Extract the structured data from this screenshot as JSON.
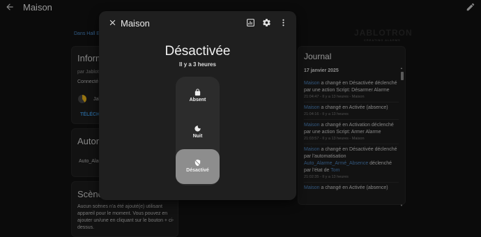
{
  "topbar": {
    "title": "Maison"
  },
  "background": {
    "breadcrumb": "Dans Hall Ent",
    "brand": "JABLOTRON",
    "brand_sub": "CREATING ALARMS",
    "info_card": {
      "title": "Inform",
      "by": "par Jablot",
      "connected": "Connecté v",
      "device": "Jab",
      "action": "TÉLÉCHA"
    },
    "auto_card": {
      "title": "Autom",
      "item": "Auto_Alar"
    },
    "scenes_card": {
      "title": "Scènes",
      "text": "Aucun scènes n'a été ajouté(e) utilisant appareil pour le moment. Vous pouvez en ajouter un/une en cliquant sur le bouton + ci-dessus."
    }
  },
  "journal": {
    "title": "Journal",
    "date": "17 janvier 2025",
    "entries": [
      {
        "entity": "Maison",
        "text": " a changé en Désactivée déclenché par une action Script: Désarmer Alarme",
        "meta": "21:04:47 - Il y a 13 heures - Maison"
      },
      {
        "entity": "Maison",
        "text": " a changé en Activée (absence)",
        "meta": "21:04:16 - Il y a 13 heures"
      },
      {
        "entity": "Maison",
        "text": " a changé en Activation déclenché par une action Script: Armer Alarme",
        "meta": "21:03:57 - Il y a 13 heures - Maison"
      },
      {
        "entity": "Maison",
        "text": " a changé en Désactivée déclenché par l'automatisation ",
        "link": "Auto_Alarme_Armé_Absence",
        "text2": " déclenché par l'état de ",
        "link2": "Tom",
        "meta": "21:02:35 - Il y a 13 heures"
      },
      {
        "entity": "Maison",
        "text": " a changé en Activée (absence)",
        "meta": ""
      }
    ]
  },
  "dialog": {
    "title": "Maison",
    "state": "Désactivée",
    "since": "Il y a 3 heures",
    "modes": [
      {
        "label": "Absent",
        "icon": "lock-icon"
      },
      {
        "label": "Nuit",
        "icon": "moon-icon"
      },
      {
        "label": "Désactivé",
        "icon": "shield-off-icon",
        "active": true
      }
    ]
  },
  "colors": {
    "accent": "#4f86c0",
    "active_mode": "#8d8d8d",
    "dialog_bg": "#1f1f1f"
  }
}
